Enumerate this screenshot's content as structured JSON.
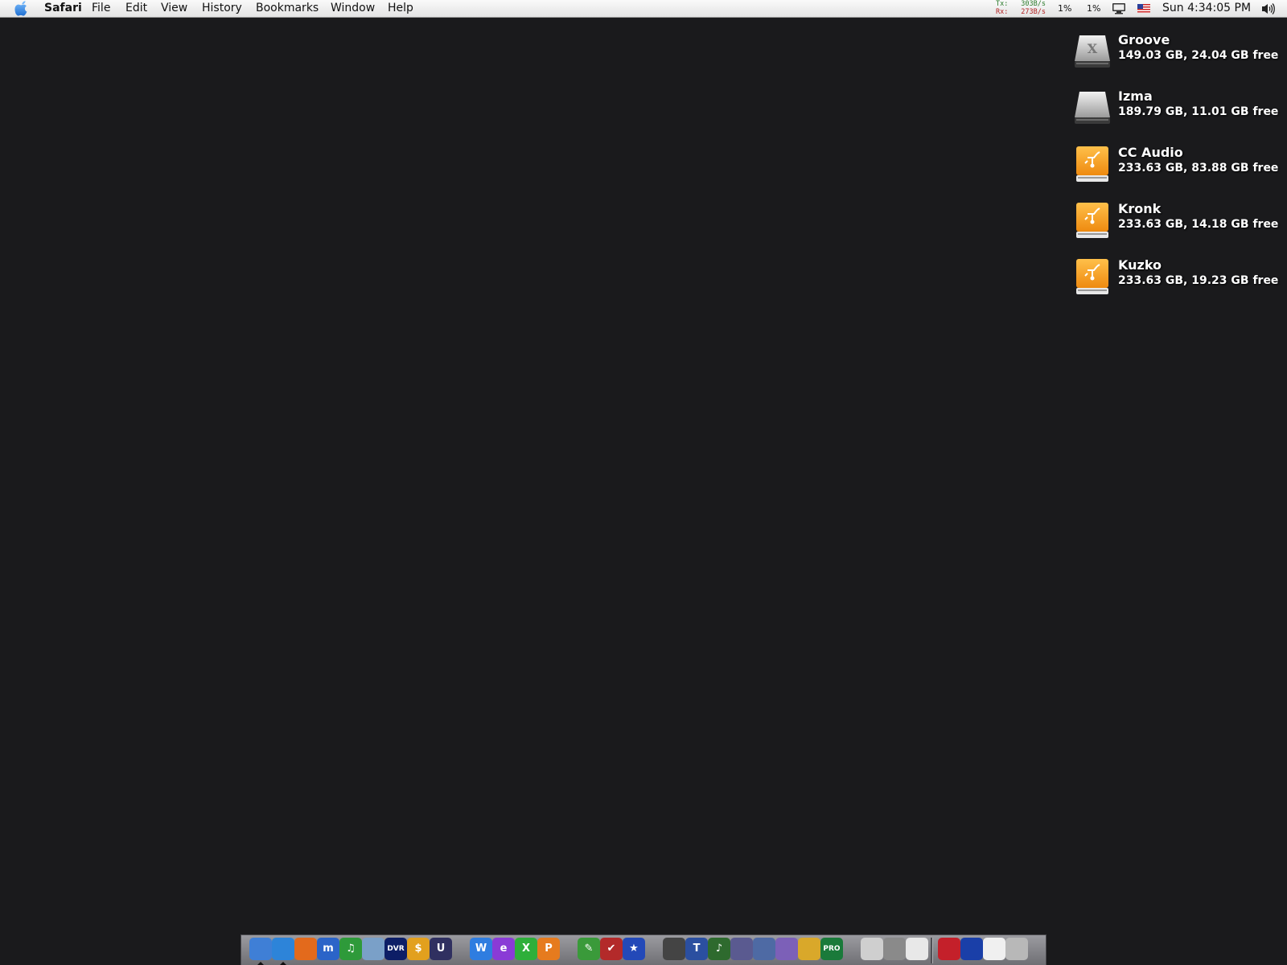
{
  "menubar": {
    "app_name": "Safari",
    "menus": [
      "File",
      "Edit",
      "View",
      "History",
      "Bookmarks",
      "Window",
      "Help"
    ],
    "network": {
      "tx_label": "Tx:",
      "tx_value": "303B/s",
      "rx_label": "Rx:",
      "rx_value": "273B/s"
    },
    "cpu1": "1%",
    "cpu2": "1%",
    "clock": "Sun 4:34:05 PM",
    "icons": [
      "apple-menu-icon",
      "display-icon",
      "us-flag-icon",
      "volume-icon"
    ]
  },
  "volumes": [
    {
      "name": "Groove",
      "info": "149.03 GB, 24.04 GB free",
      "icon": "internal-drive-x-icon"
    },
    {
      "name": "Izma",
      "info": "189.79 GB, 11.01 GB free",
      "icon": "internal-drive-icon"
    },
    {
      "name": "CC Audio",
      "info": "233.63 GB, 83.88 GB free",
      "icon": "firewire-drive-icon"
    },
    {
      "name": "Kronk",
      "info": "233.63 GB, 14.18 GB free",
      "icon": "firewire-drive-icon"
    },
    {
      "name": "Kuzko",
      "info": "233.63 GB, 19.23 GB free",
      "icon": "firewire-drive-icon"
    }
  ],
  "dock": {
    "apps": [
      {
        "name": "finder-icon",
        "glyph": "",
        "bg": "#3f7fd6"
      },
      {
        "name": "safari-icon",
        "glyph": "",
        "bg": "#2d84d9"
      },
      {
        "name": "firefox-icon",
        "glyph": "",
        "bg": "#e36a1c"
      },
      {
        "name": "m-app-icon",
        "glyph": "m",
        "bg": "#2b64c8"
      },
      {
        "name": "music-app-icon",
        "glyph": "♫",
        "bg": "#2e9a3a"
      },
      {
        "name": "photo-app-icon",
        "glyph": "",
        "bg": "#7aa0c8"
      },
      {
        "name": "dvr-icon",
        "glyph": "DVR",
        "bg": "#0d1e66"
      },
      {
        "name": "dollar-icon",
        "glyph": "$",
        "bg": "#e2a01e"
      },
      {
        "name": "u-app-icon",
        "glyph": "U",
        "bg": "#303060"
      },
      {
        "name": "w-app-icon",
        "glyph": "W",
        "bg": "#2f7de0"
      },
      {
        "name": "e-app-icon",
        "glyph": "e",
        "bg": "#8a3bd6"
      },
      {
        "name": "x-app-icon",
        "glyph": "X",
        "bg": "#2eaf3a"
      },
      {
        "name": "p-app-icon",
        "glyph": "P",
        "bg": "#e67b1e"
      },
      {
        "name": "green-pen-icon",
        "glyph": "✎",
        "bg": "#3a9a3a"
      },
      {
        "name": "red-check-icon",
        "glyph": "✔",
        "bg": "#b32a2a"
      },
      {
        "name": "blue-star-icon",
        "glyph": "★",
        "bg": "#2349b8"
      },
      {
        "name": "clapboard-icon",
        "glyph": "",
        "bg": "#444"
      },
      {
        "name": "t-app-icon",
        "glyph": "T",
        "bg": "#2b4fa0"
      },
      {
        "name": "music-clapboard-icon",
        "glyph": "♪",
        "bg": "#2e6a2e"
      },
      {
        "name": "dvd-app-icon",
        "glyph": "",
        "bg": "#5a5a90"
      },
      {
        "name": "compressor-icon",
        "glyph": "",
        "bg": "#4e6aa4"
      },
      {
        "name": "disc-app-icon",
        "glyph": "",
        "bg": "#7c60b8"
      },
      {
        "name": "film-app-icon",
        "glyph": "",
        "bg": "#d9a82a"
      },
      {
        "name": "pro-tools-icon",
        "glyph": "PRO",
        "bg": "#1a7a3a"
      },
      {
        "name": "printer-icon",
        "glyph": "",
        "bg": "#cfcfcf"
      },
      {
        "name": "system-prefs-icon",
        "glyph": "",
        "bg": "#8a8a8a"
      },
      {
        "name": "apple-app-icon",
        "glyph": "",
        "bg": "#e8e8e8"
      }
    ],
    "docs": [
      {
        "name": "red-folder-icon",
        "glyph": "",
        "bg": "#c4202a"
      },
      {
        "name": "blue-folder-icon",
        "glyph": "",
        "bg": "#1a3fa8"
      },
      {
        "name": "document-icon",
        "glyph": "",
        "bg": "#f0f0f0"
      },
      {
        "name": "trash-icon",
        "glyph": "",
        "bg": "#b8b8b8"
      }
    ]
  }
}
